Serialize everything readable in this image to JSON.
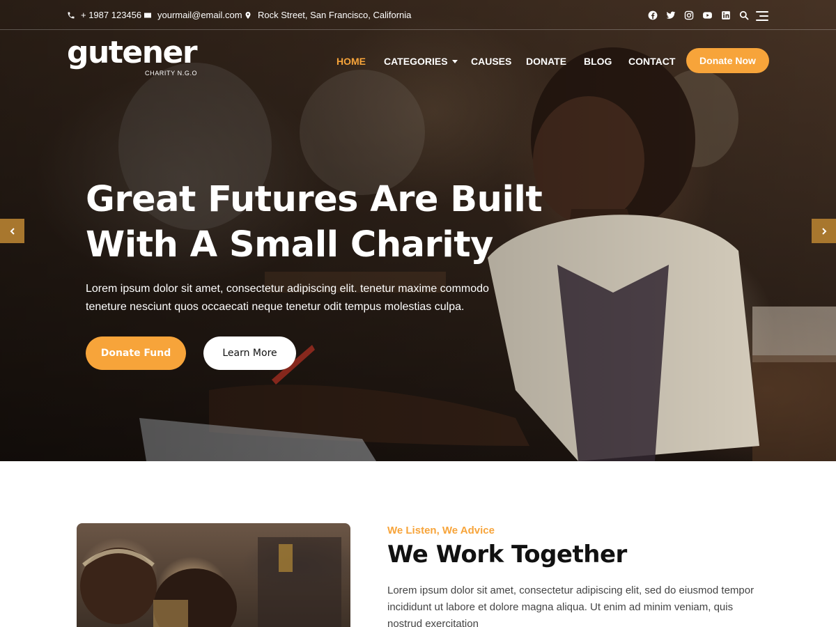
{
  "topbar": {
    "phone": "+ 1987 123456",
    "email": "yourmail@email.com",
    "address": "Rock Street, San Francisco, California",
    "social_icons": [
      "facebook-icon",
      "twitter-icon",
      "instagram-icon",
      "youtube-icon",
      "linkedin-icon",
      "search-icon",
      "menu-icon"
    ]
  },
  "brand": {
    "name": "gutener",
    "tagline": "CHARITY N.G.O"
  },
  "nav": {
    "items": [
      {
        "label": "HOME",
        "active": true
      },
      {
        "label": "CATEGORIES",
        "active": false
      },
      {
        "label": "CAUSES",
        "active": false
      },
      {
        "label": "DONATE",
        "active": false
      },
      {
        "label": "BLOG",
        "active": false
      },
      {
        "label": "CONTACT",
        "active": false
      }
    ],
    "cta_label": "Donate Now"
  },
  "hero": {
    "title_line1": "Great Futures Are Built",
    "title_line2": "With A Small Charity",
    "description": "Lorem ipsum dolor sit amet, consectetur adipiscing elit. tenetur maxime commodo teneture nesciunt quos occaecati neque tenetur odit tempus molestias culpa.",
    "primary_button": "Donate Fund",
    "secondary_button": "Learn More"
  },
  "about": {
    "eyebrow": "We Listen, We Advice",
    "title": "We Work Together",
    "text": "Lorem ipsum dolor sit amet, consectetur adipiscing elit, sed do eiusmod tempor incididunt ut labore et dolore magna aliqua. Ut enim ad minim veniam, quis nostrud exercitation"
  },
  "colors": {
    "accent": "#f7a43a",
    "arrow_bg": "#a8772e",
    "heading": "#111111",
    "body_text": "#444444"
  }
}
